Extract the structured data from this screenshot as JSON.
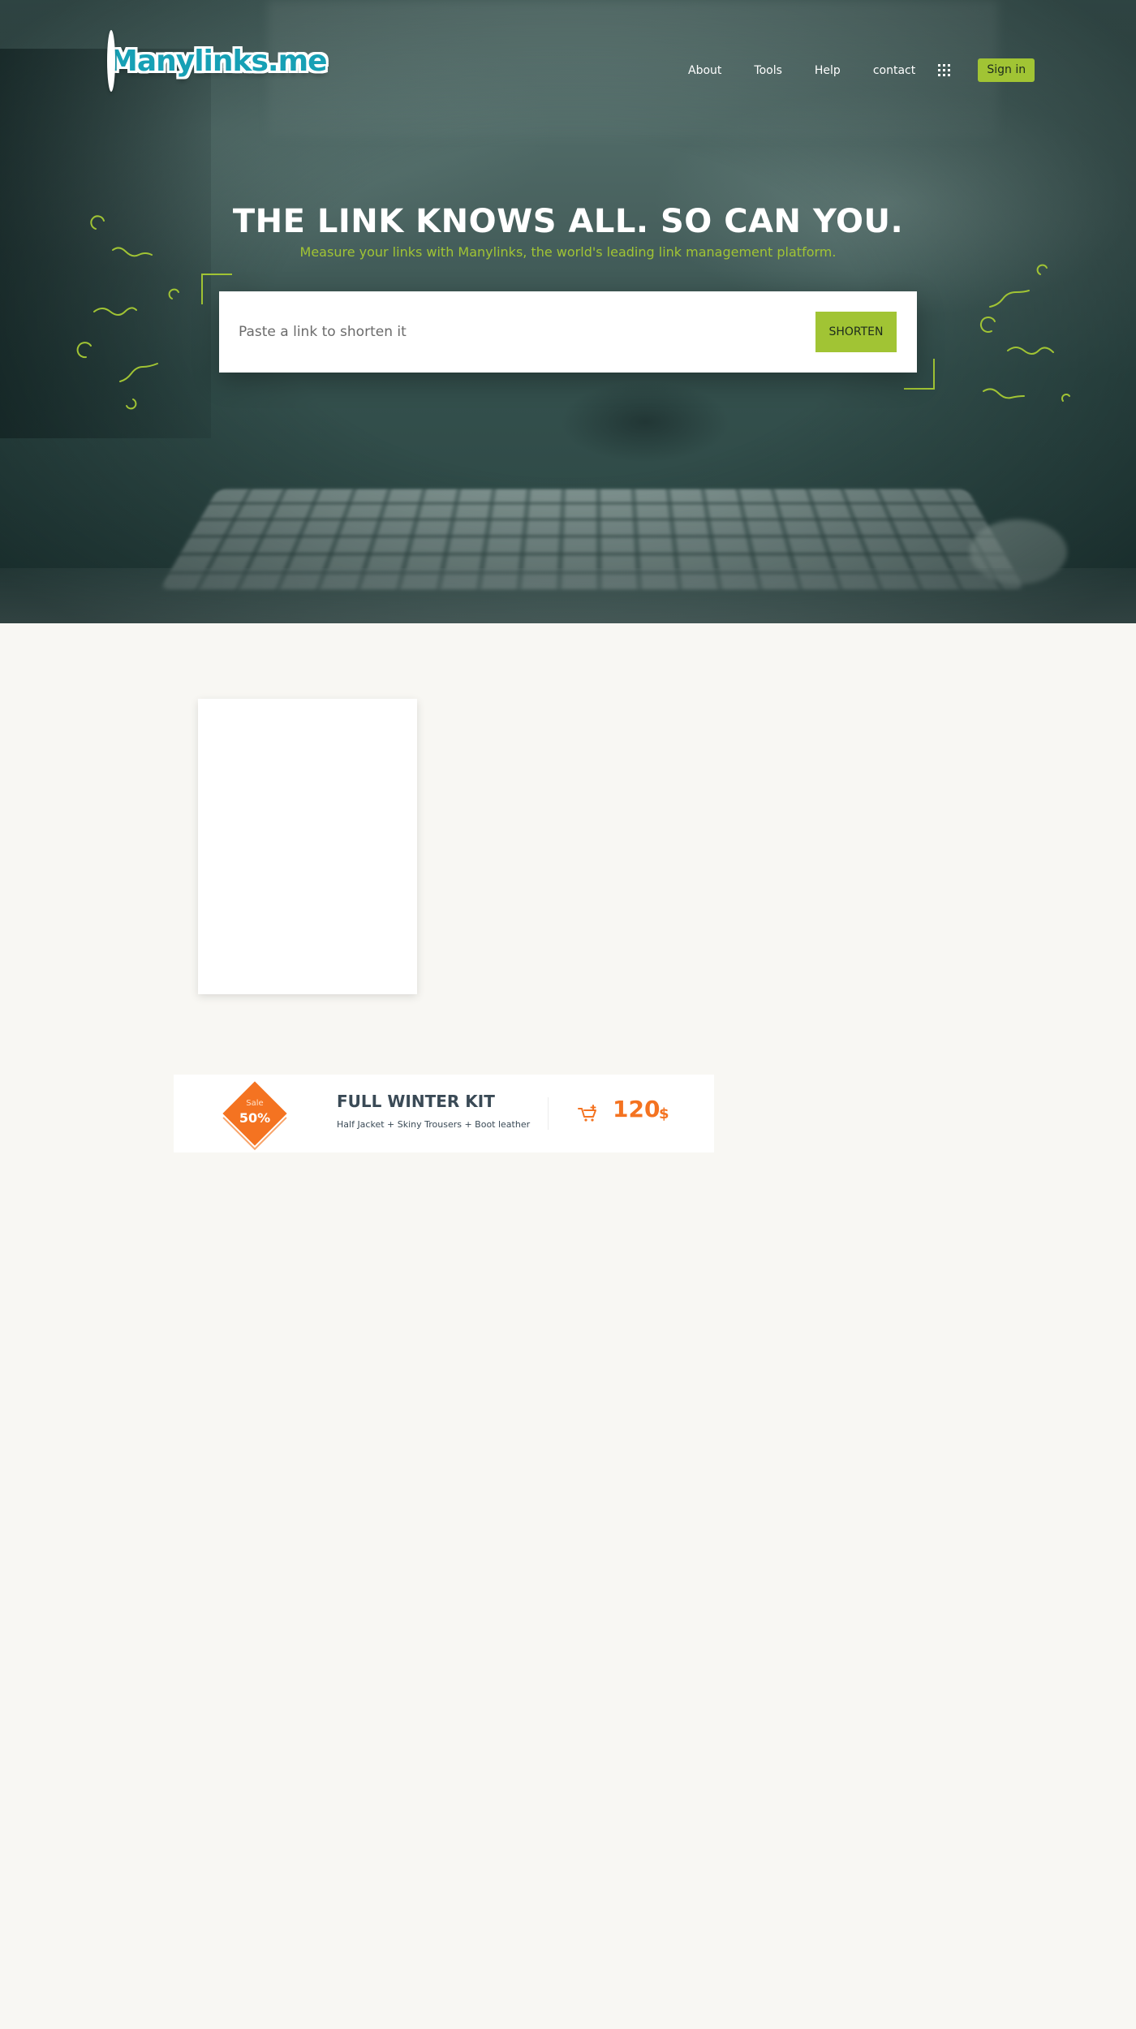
{
  "header": {
    "logo_text": "Manylinks.me",
    "nav": [
      "About",
      "Tools",
      "Help",
      "contact"
    ],
    "apps_icon": "grid-icon",
    "signin_label": "Sign in"
  },
  "hero": {
    "title": "THE LINK KNOWS ALL. SO CAN YOU.",
    "subtitle": "Measure your links with Manylinks, the world's leading link management platform.",
    "input_placeholder": "Paste a link to shorten it",
    "button_label": "SHORTEN"
  },
  "promo": {
    "badge_label": "Sale",
    "badge_value": "50%",
    "title": "FULL WINTER KIT",
    "description": "Half Jacket + Skiny Trousers + Boot leather",
    "cart_icon": "cart-icon",
    "price": "120",
    "currency": "$"
  },
  "colors": {
    "accent_green": "#a1c434",
    "sale_orange": "#f47321",
    "page_background": "#f8f7f3",
    "promo_text": "#3a4a56"
  }
}
